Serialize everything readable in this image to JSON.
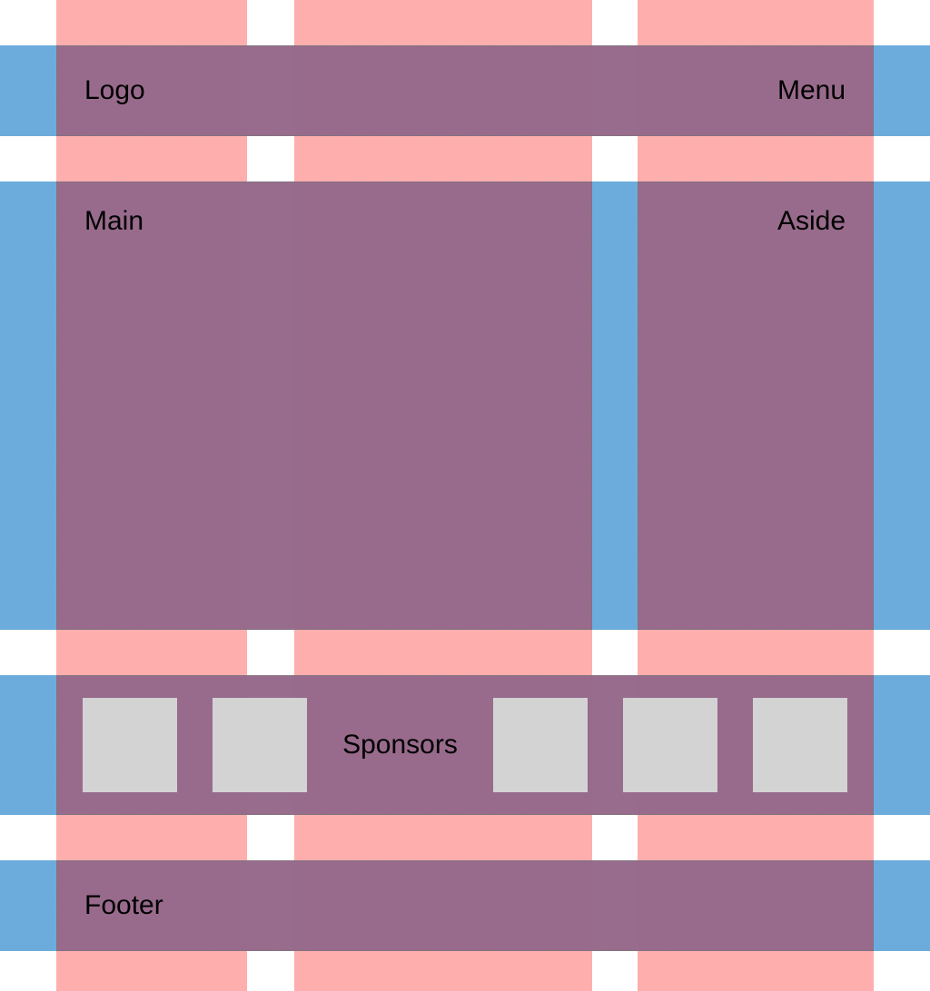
{
  "header": {
    "logo": "Logo",
    "menu": "Menu"
  },
  "content": {
    "main": "Main",
    "aside": "Aside"
  },
  "sponsors": {
    "label": "Sponsors",
    "count": 5
  },
  "footer": {
    "label": "Footer"
  }
}
